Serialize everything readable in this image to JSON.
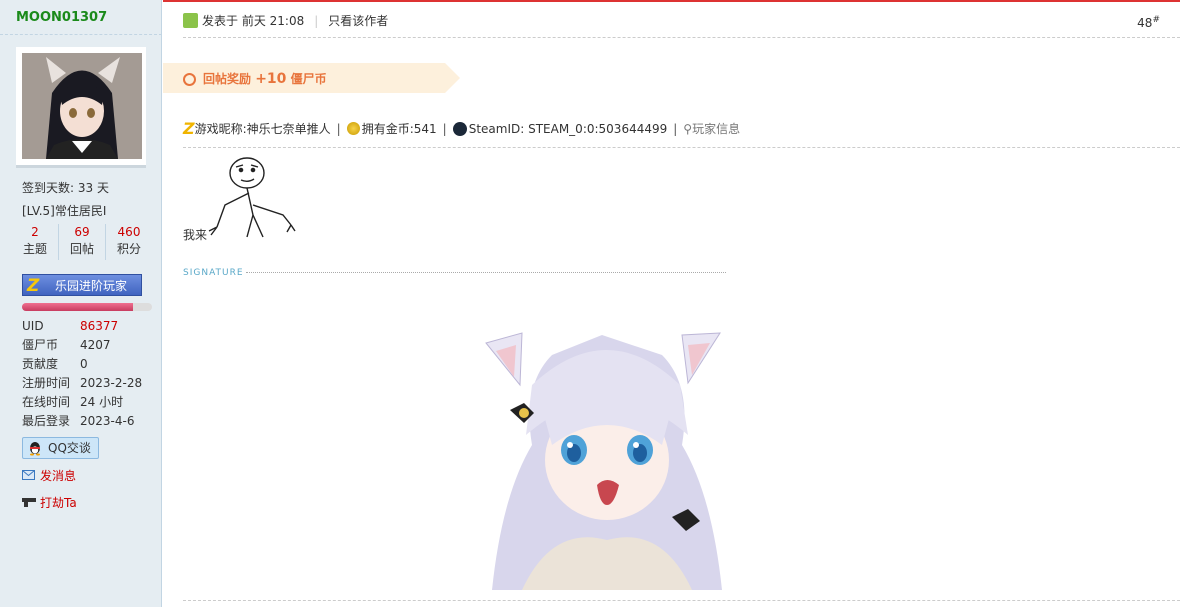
{
  "user": {
    "name": "MOON01307",
    "checkin": "签到天数: 33 天",
    "level": "[LV.5]常住居民I",
    "stats": [
      {
        "num": "2",
        "label": "主题"
      },
      {
        "num": "69",
        "label": "回帖"
      },
      {
        "num": "460",
        "label": "积分"
      }
    ],
    "medal": "乐园进阶玩家",
    "progress": 0.85,
    "fields": [
      {
        "k": "UID",
        "v": "86377"
      },
      {
        "k": "僵尸币",
        "v": "4207"
      },
      {
        "k": "贡献度",
        "v": "0"
      },
      {
        "k": "注册时间",
        "v": "2023-2-28"
      },
      {
        "k": "在线时间",
        "v": "24 小时"
      },
      {
        "k": "最后登录",
        "v": "2023-4-6"
      }
    ],
    "qq": "QQ交谈",
    "send_msg": "发消息",
    "rob": "打劫Ta"
  },
  "post": {
    "posted": "发表于 前天 21:08",
    "only_author": "只看该作者",
    "floor": "48",
    "floor_mark": "#",
    "reward_label": "回帖奖励",
    "reward_amount": "+10",
    "reward_unit": "僵尸币",
    "nickname": "游戏昵称:神乐七奈单推人",
    "gold": "拥有金币:541",
    "steam": "SteamID: STEAM_0:0:503644499",
    "player_info": "玩家信息",
    "message": "我来",
    "signature_label": "SIGNATURE"
  },
  "colors": {
    "accent": "#cc0000",
    "reward": "#e8743c",
    "username": "#1a8a1a"
  }
}
